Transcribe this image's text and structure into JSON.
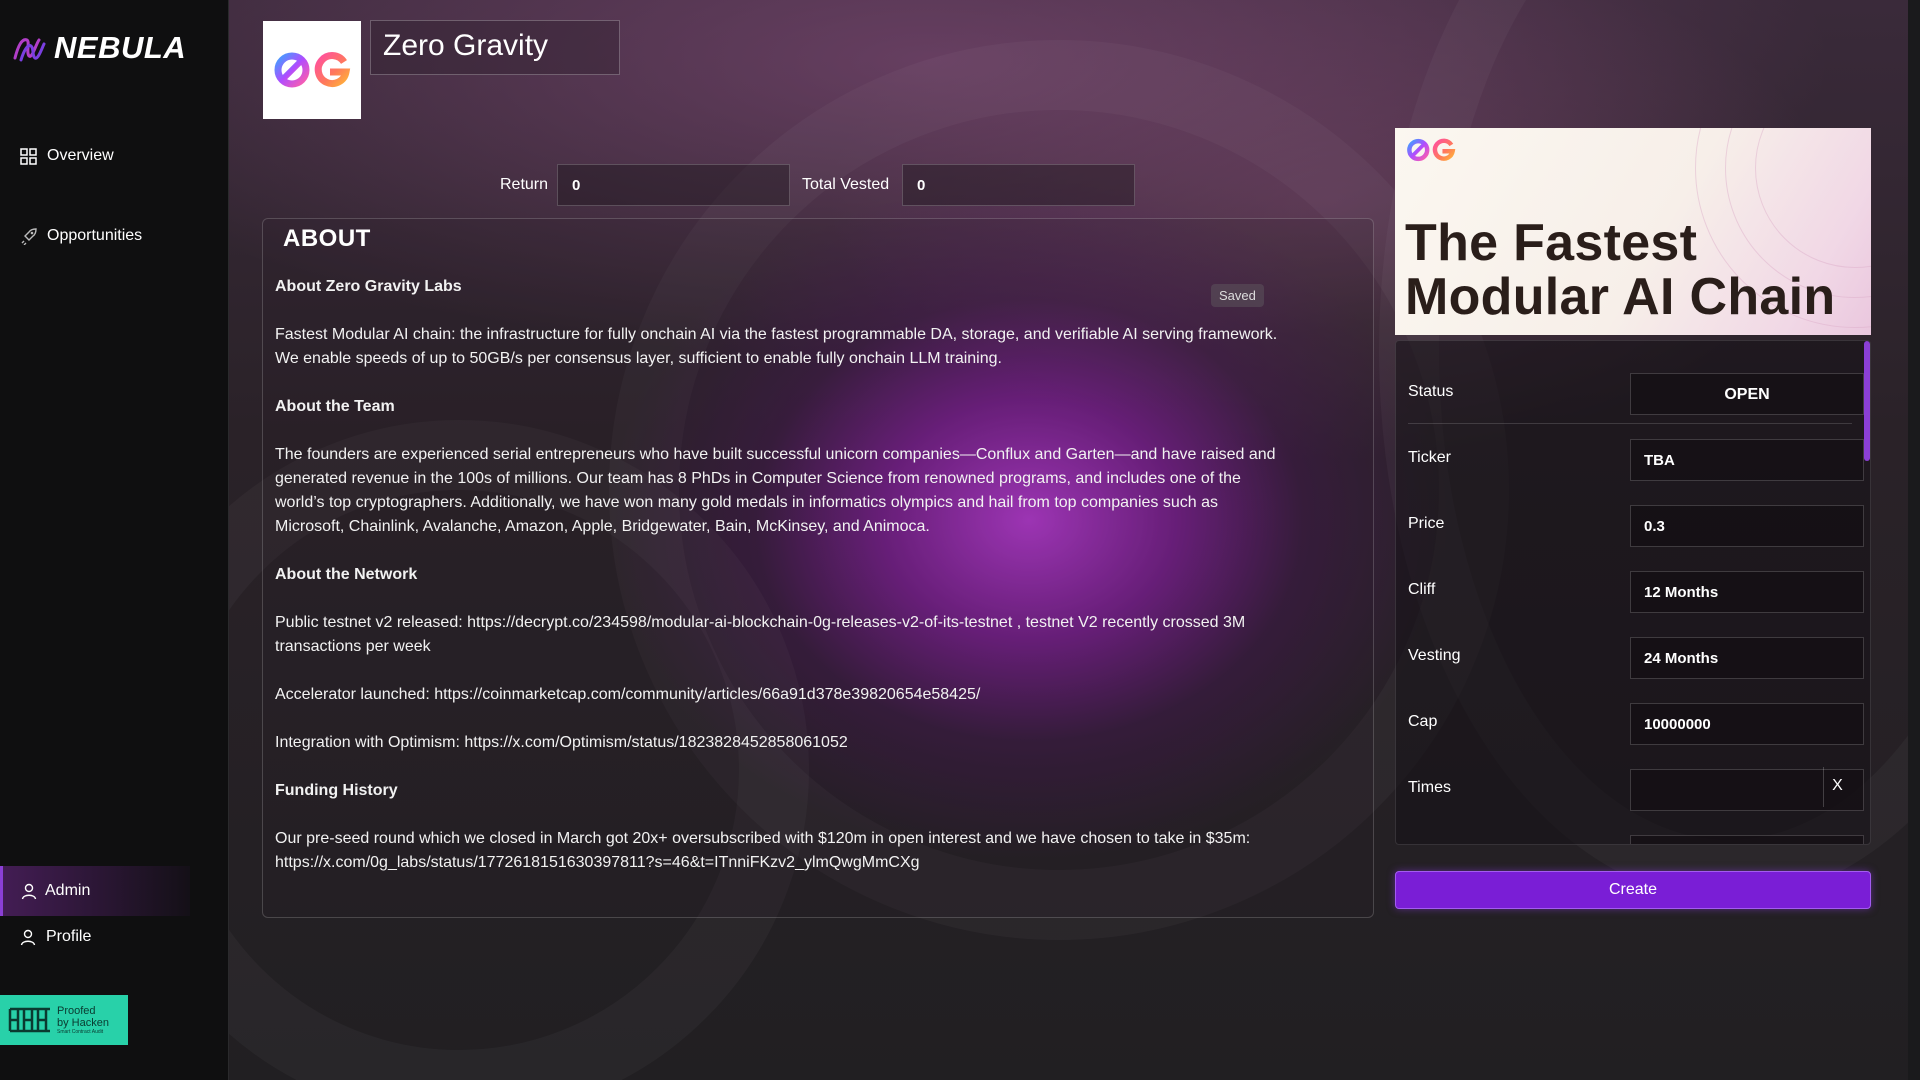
{
  "sidebar": {
    "brand": "NEBULA",
    "nav": [
      {
        "label": "Overview",
        "icon": "grid-icon"
      },
      {
        "label": "Opportunities",
        "icon": "rocket-icon"
      }
    ],
    "admin_label": "Admin",
    "profile_label": "Profile",
    "hacken": {
      "line1": "Proofed",
      "line2": "by Hacken",
      "line3": "Smart Contract Audit"
    }
  },
  "project": {
    "name": "Zero Gravity"
  },
  "metrics": {
    "return_label": "Return",
    "return_value": "0",
    "total_vested_label": "Total Vested",
    "total_vested_value": "0"
  },
  "about": {
    "title": "ABOUT",
    "saved_badge": "Saved",
    "sections": [
      {
        "heading": "About Zero Gravity Labs"
      },
      {
        "text": "Fastest Modular AI chain: the infrastructure for fully onchain AI via the fastest programmable DA, storage, and verifiable AI serving framework. We enable speeds of up to 50GB/s per consensus layer, sufficient to enable fully onchain LLM training."
      },
      {
        "heading": "About the Team"
      },
      {
        "text": "The founders are experienced serial entrepreneurs who have built successful unicorn companies—Conflux and Garten—and have raised and generated revenue in the 100s of millions. Our team has 8 PhDs in Computer Science from renowned programs, and includes one of the world’s top cryptographers. Additionally, we have won many gold medals in informatics olympics and hail from top companies such as Microsoft, Chainlink, Avalanche, Amazon, Apple, Bridgewater, Bain, McKinsey, and Animoca."
      },
      {
        "heading": "About the Network"
      },
      {
        "text": "Public testnet v2 released: https://decrypt.co/234598/modular-ai-blockchain-0g-releases-v2-of-its-testnet , testnet V2 recently crossed 3M transactions per week"
      },
      {
        "text": "Accelerator launched: https://coinmarketcap.com/community/articles/66a91d378e39820654e58425/"
      },
      {
        "text": "Integration with Optimism: https://x.com/Optimism/status/1823828452858061052"
      },
      {
        "heading": "Funding History"
      },
      {
        "text": "Our pre-seed round which we closed in March got 20x+ oversubscribed with $120m in open interest and we have chosen to take in $35m: https://x.com/0g_labs/status/1772618151630397811?s=46&t=ITnniFKzv2_ylmQwgMmCXg"
      }
    ]
  },
  "banner": {
    "title_line1": "The Fastest",
    "title_line2": "Modular AI Chain"
  },
  "details": {
    "status_label": "Status",
    "status_value": "OPEN",
    "ticker_label": "Ticker",
    "ticker_value": "TBA",
    "price_label": "Price",
    "price_value": "0.3",
    "cliff_label": "Cliff",
    "cliff_value": "12 Months",
    "vesting_label": "Vesting",
    "vesting_value": "24 Months",
    "cap_label": "Cap",
    "cap_value": "10000000",
    "times_label": "Times",
    "times_value": "",
    "clear_label": "X"
  },
  "actions": {
    "create_label": "Create"
  },
  "colors": {
    "accent": "#7a1ed6",
    "hacken": "#28d1a9"
  }
}
